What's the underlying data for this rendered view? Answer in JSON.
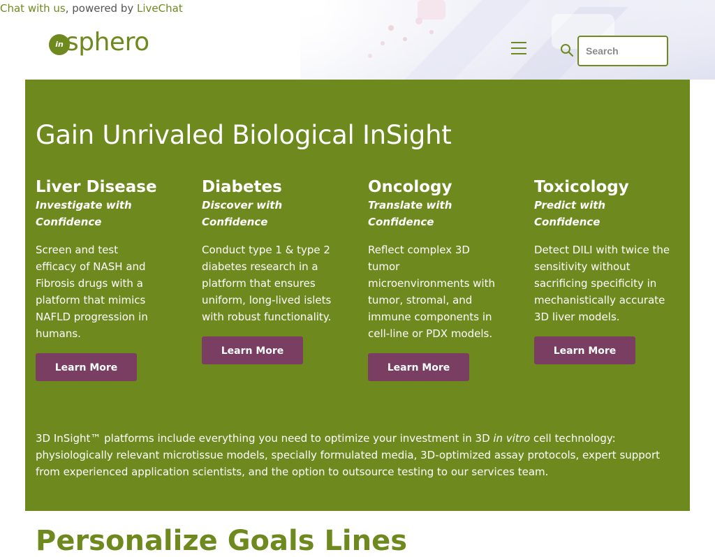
{
  "chat_bar": {
    "link_text": "Chat with us",
    "middle_text": ", powered by ",
    "provider_text": "LiveChat"
  },
  "header": {
    "logo": {
      "prefix": "in",
      "text": "sphero"
    },
    "search": {
      "placeholder": "Search",
      "value": ""
    },
    "menu_icon": "hamburger-icon",
    "search_icon": "magnifier-icon"
  },
  "hero": {
    "title": "Gain Unrivaled Biological InSight",
    "columns": [
      {
        "heading": "Liver Disease",
        "subtitle": "Investigate with Confidence",
        "body": "Screen and test efficacy of NASH and Fibrosis drugs with a platform that mimics NAFLD progression in humans.",
        "button": "Learn More"
      },
      {
        "heading": "Diabetes",
        "subtitle": "Discover with Confidence",
        "body": "Conduct type 1 & type 2 diabetes research in a platform that ensures uniform, long-lived islets with robust functionality.",
        "button": "Learn More"
      },
      {
        "heading": "Oncology",
        "subtitle": "Translate with Confidence",
        "body": "Reflect complex 3D tumor microenvironments with tumor, stromal, and immune components in cell-line or PDX models.",
        "button": "Learn More"
      },
      {
        "heading": "Toxicology",
        "subtitle": "Predict with Confidence",
        "body": "Detect DILI with twice the sensitivity without sacrificing specificity in mechanistically accurate 3D liver models.",
        "button": "Learn More"
      }
    ],
    "footer": {
      "before": "3D InSight™ platforms include everything you need to optimize your investment in 3D ",
      "emphasis": "in vitro",
      "after": " cell technology: physiologically relevant microtissue models, specially formulated media, 3D-optimized assay protocols, expert support from experienced application scientists, and the option to outsource testing to our services team."
    }
  },
  "next_section": {
    "heading": "Personalize Goals Lines"
  },
  "colors": {
    "brand_green": "#6e8a1f",
    "button_purple": "#793e62",
    "text_white": "#ffffff"
  }
}
